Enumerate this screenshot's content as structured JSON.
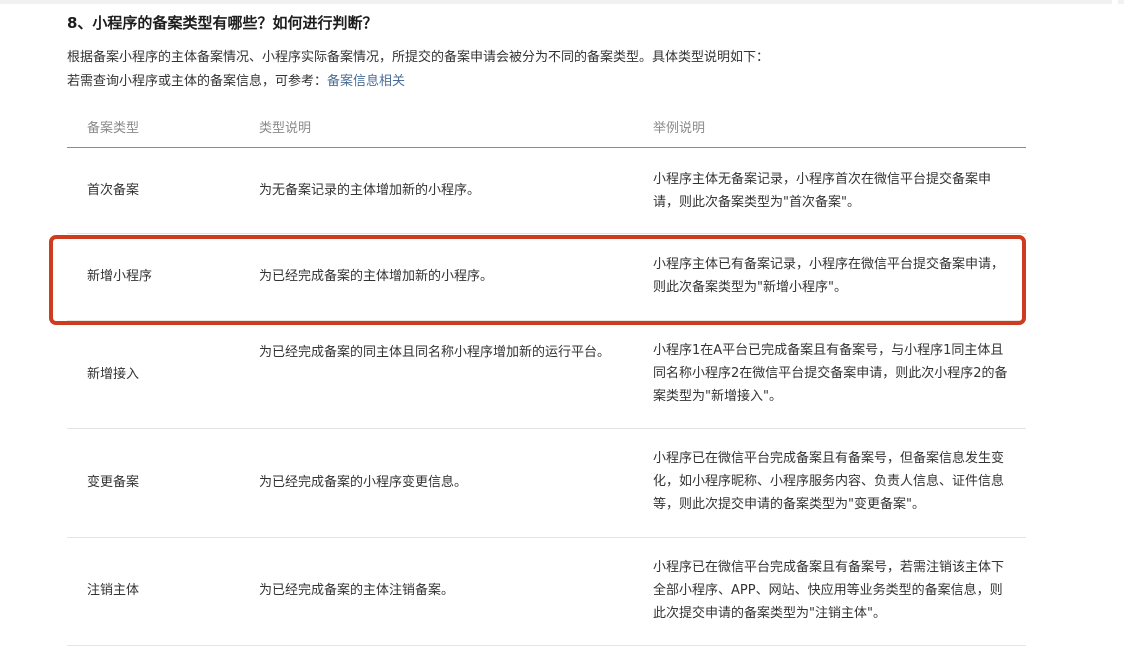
{
  "heading": "8、小程序的备案类型有哪些？如何进行判断？",
  "intro": {
    "line1": "根据备案小程序的主体备案情况、小程序实际备案情况，所提交的备案申请会被分为不同的备案类型。具体类型说明如下：",
    "line2_prefix": "若需查询小程序或主体的备案信息，可参考：",
    "line2_link": "备案信息相关"
  },
  "table": {
    "headers": [
      "备案类型",
      "类型说明",
      "举例说明"
    ],
    "rows": [
      {
        "type": "首次备案",
        "desc": "为无备案记录的主体增加新的小程序。",
        "example": "小程序主体无备案记录，小程序首次在微信平台提交备案申请，则此次备案类型为\"首次备案\"。"
      },
      {
        "type": "新增小程序",
        "desc": "为已经完成备案的主体增加新的小程序。",
        "example": "小程序主体已有备案记录，小程序在微信平台提交备案申请，则此次备案类型为\"新增小程序\"。"
      },
      {
        "type": "新增接入",
        "desc": "为已经完成备案的同主体且同名称小程序增加新的运行平台。",
        "example": "小程序1在A平台已完成备案且有备案号，与小程序1同主体且同名称小程序2在微信平台提交备案申请，则此次小程序2的备案类型为\"新增接入\"。"
      },
      {
        "type": "变更备案",
        "desc": "为已经完成备案的小程序变更信息。",
        "example": "小程序已在微信平台完成备案且有备案号，但备案信息发生变化，如小程序昵称、小程序服务内容、负责人信息、证件信息等，则此次提交申请的备案类型为\"变更备案\"。"
      },
      {
        "type": "注销主体",
        "desc": "为已经完成备案的主体注销备案。",
        "example": "小程序已在微信平台完成备案且有备案号，若需注销该主体下全部小程序、APP、网站、快应用等业务类型的备案信息，则此次提交申请的备案类型为\"注销主体\"。"
      }
    ]
  },
  "colors": {
    "highlight": "#cf3b1e",
    "link": "#4a6d99"
  }
}
